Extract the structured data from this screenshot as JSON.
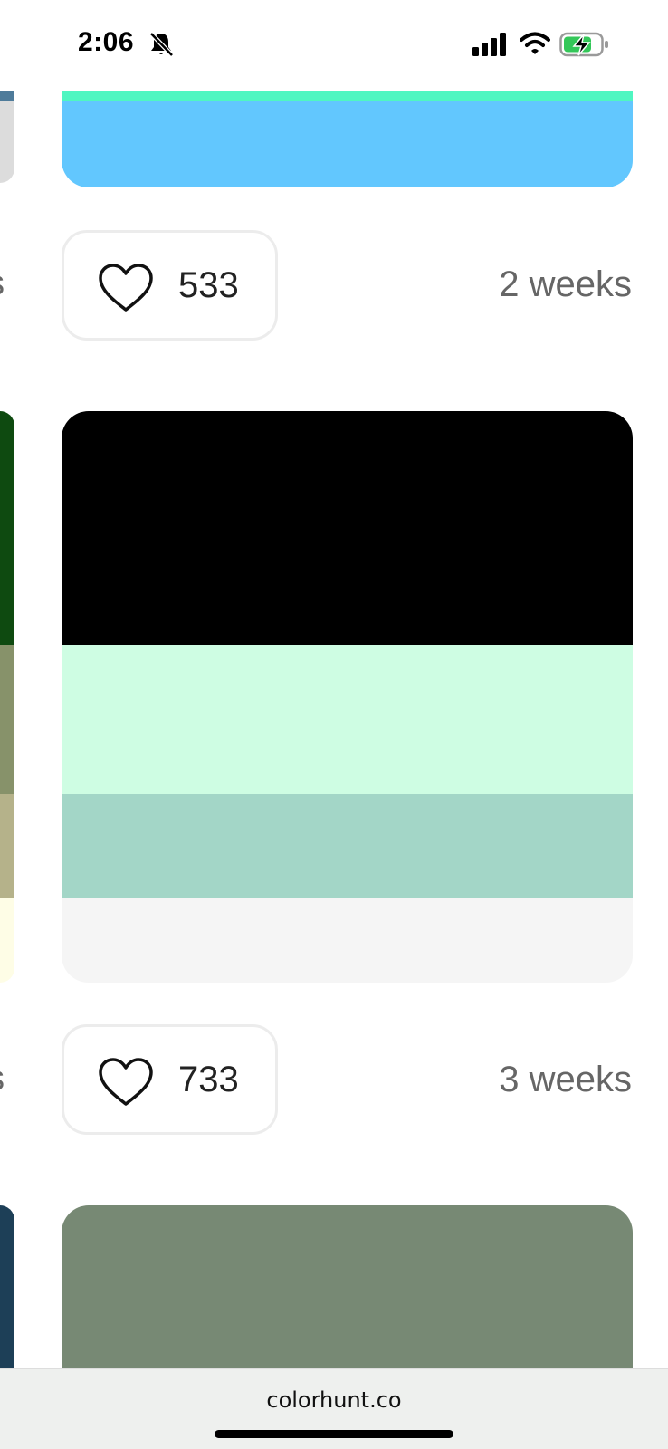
{
  "status_bar": {
    "time": "2:06",
    "icons": [
      "bell-slash-icon",
      "cellular-signal-icon",
      "wifi-icon",
      "battery-charging-icon"
    ],
    "battery_color": "#34c759"
  },
  "left_column": {
    "edge_texts": [
      "s",
      "s"
    ],
    "swatches": [
      "#dcdcdc",
      "#0e4a10",
      "#87926a",
      "#b5b28a",
      "#fefde6",
      "#1d3f57"
    ]
  },
  "palettes": [
    {
      "colors": [
        "#4ff6c1",
        "#62c7fe"
      ]
    },
    {
      "colors": [
        "#000000",
        "#cefde3",
        "#a3d6c7",
        "#f5f5f5"
      ]
    },
    {
      "colors": [
        "#778974"
      ]
    }
  ],
  "entries": [
    {
      "likes": "533",
      "time_ago": "2 weeks"
    },
    {
      "likes": "733",
      "time_ago": "3 weeks"
    }
  ],
  "browser": {
    "url": "colorhunt.co"
  }
}
